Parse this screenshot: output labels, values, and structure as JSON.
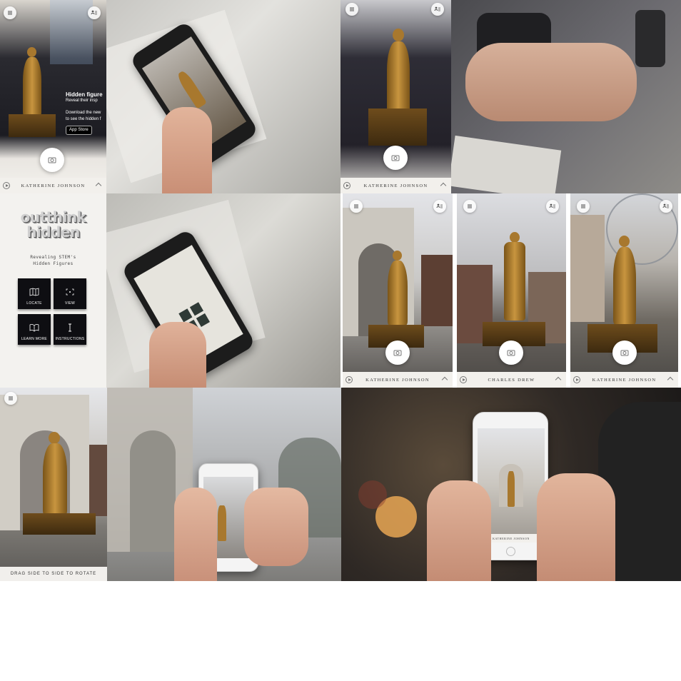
{
  "colors": {
    "bar_bg": "#f2f0ec",
    "bronze": "#a8782e",
    "menu_tile": "#0e0e12"
  },
  "icons": {
    "menu": "menu-icon",
    "people": "people-list-icon",
    "camera": "camera-icon",
    "play": "play-icon",
    "chevron": "chevron-up-icon"
  },
  "panel1": {
    "heading": "Hidden figure",
    "tagline": "Reveal their insp",
    "body_line1": "Download the new",
    "body_line2": "to see the hidden f",
    "store_badge": "App Store",
    "figure_label": "KATHERINE JOHNSON"
  },
  "panel3": {
    "figure_label": "KATHERINE JOHNSON"
  },
  "menu": {
    "logo_line1": "outthink",
    "logo_line2": "hidden",
    "subtitle_line1": "Revealing STEM's",
    "subtitle_line2": "Hidden Figures",
    "tiles": [
      {
        "label": "LOCATE"
      },
      {
        "label": "VIEW"
      },
      {
        "label": "LEARN MORE"
      },
      {
        "label": "INSTRUCTIONS"
      }
    ]
  },
  "ar_views": [
    {
      "figure_label": "KATHERINE JOHNSON"
    },
    {
      "figure_label": "CHARLES DREW"
    },
    {
      "figure_label": "KATHERINE JOHNSON"
    }
  ],
  "rotate_view": {
    "caption": "DRAG SIDE TO SIDE TO ROTATE"
  },
  "phone_closeup": {
    "figure_label": "KATHERINE JOHNSON"
  }
}
